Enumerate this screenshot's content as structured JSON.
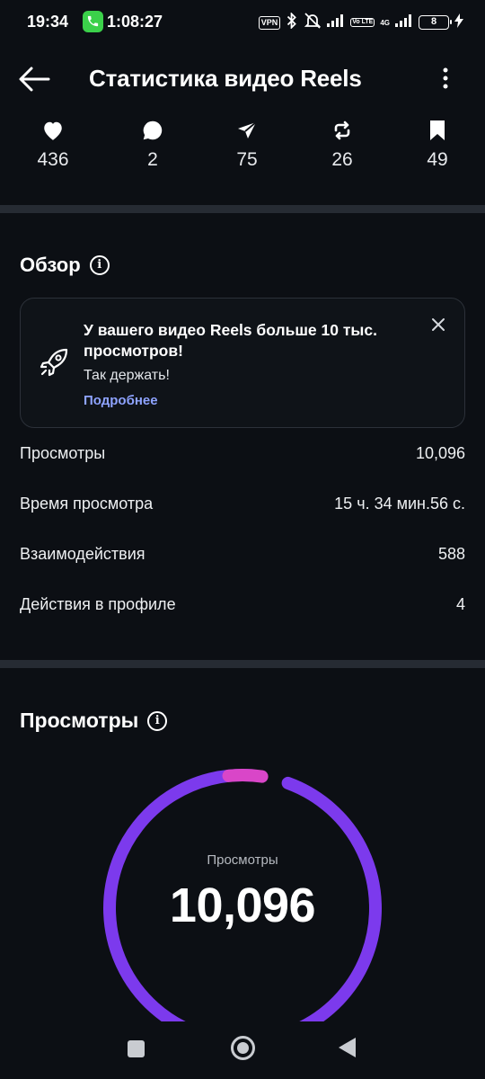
{
  "status_bar": {
    "time": "19:34",
    "call_duration": "1:08:27",
    "vpn": "VPN",
    "volte": "Vo LTE",
    "network": "4G",
    "battery": "8"
  },
  "header": {
    "title": "Статистика видео Reels"
  },
  "stats": [
    {
      "icon": "heart-icon",
      "value": "436"
    },
    {
      "icon": "comment-icon",
      "value": "2"
    },
    {
      "icon": "share-icon",
      "value": "75"
    },
    {
      "icon": "repost-icon",
      "value": "26"
    },
    {
      "icon": "bookmark-icon",
      "value": "49"
    }
  ],
  "overview": {
    "title": "Обзор",
    "banner": {
      "title": "У вашего видео Reels больше 10 тыс. просмотров!",
      "subtitle": "Так держать!",
      "link": "Подробнее"
    },
    "rows": [
      {
        "label": "Просмотры",
        "value": "10,096"
      },
      {
        "label": "Время просмотра",
        "value": "15 ч. 34 мин.56 с."
      },
      {
        "label": "Взаимодействия",
        "value": "588"
      },
      {
        "label": "Действия в профиле",
        "value": "4"
      }
    ]
  },
  "views": {
    "title": "Просмотры",
    "donut_label": "Просмотры",
    "donut_value": "10,096",
    "colors": {
      "primary": "#7c3aed",
      "secondary": "#d946c8"
    }
  }
}
